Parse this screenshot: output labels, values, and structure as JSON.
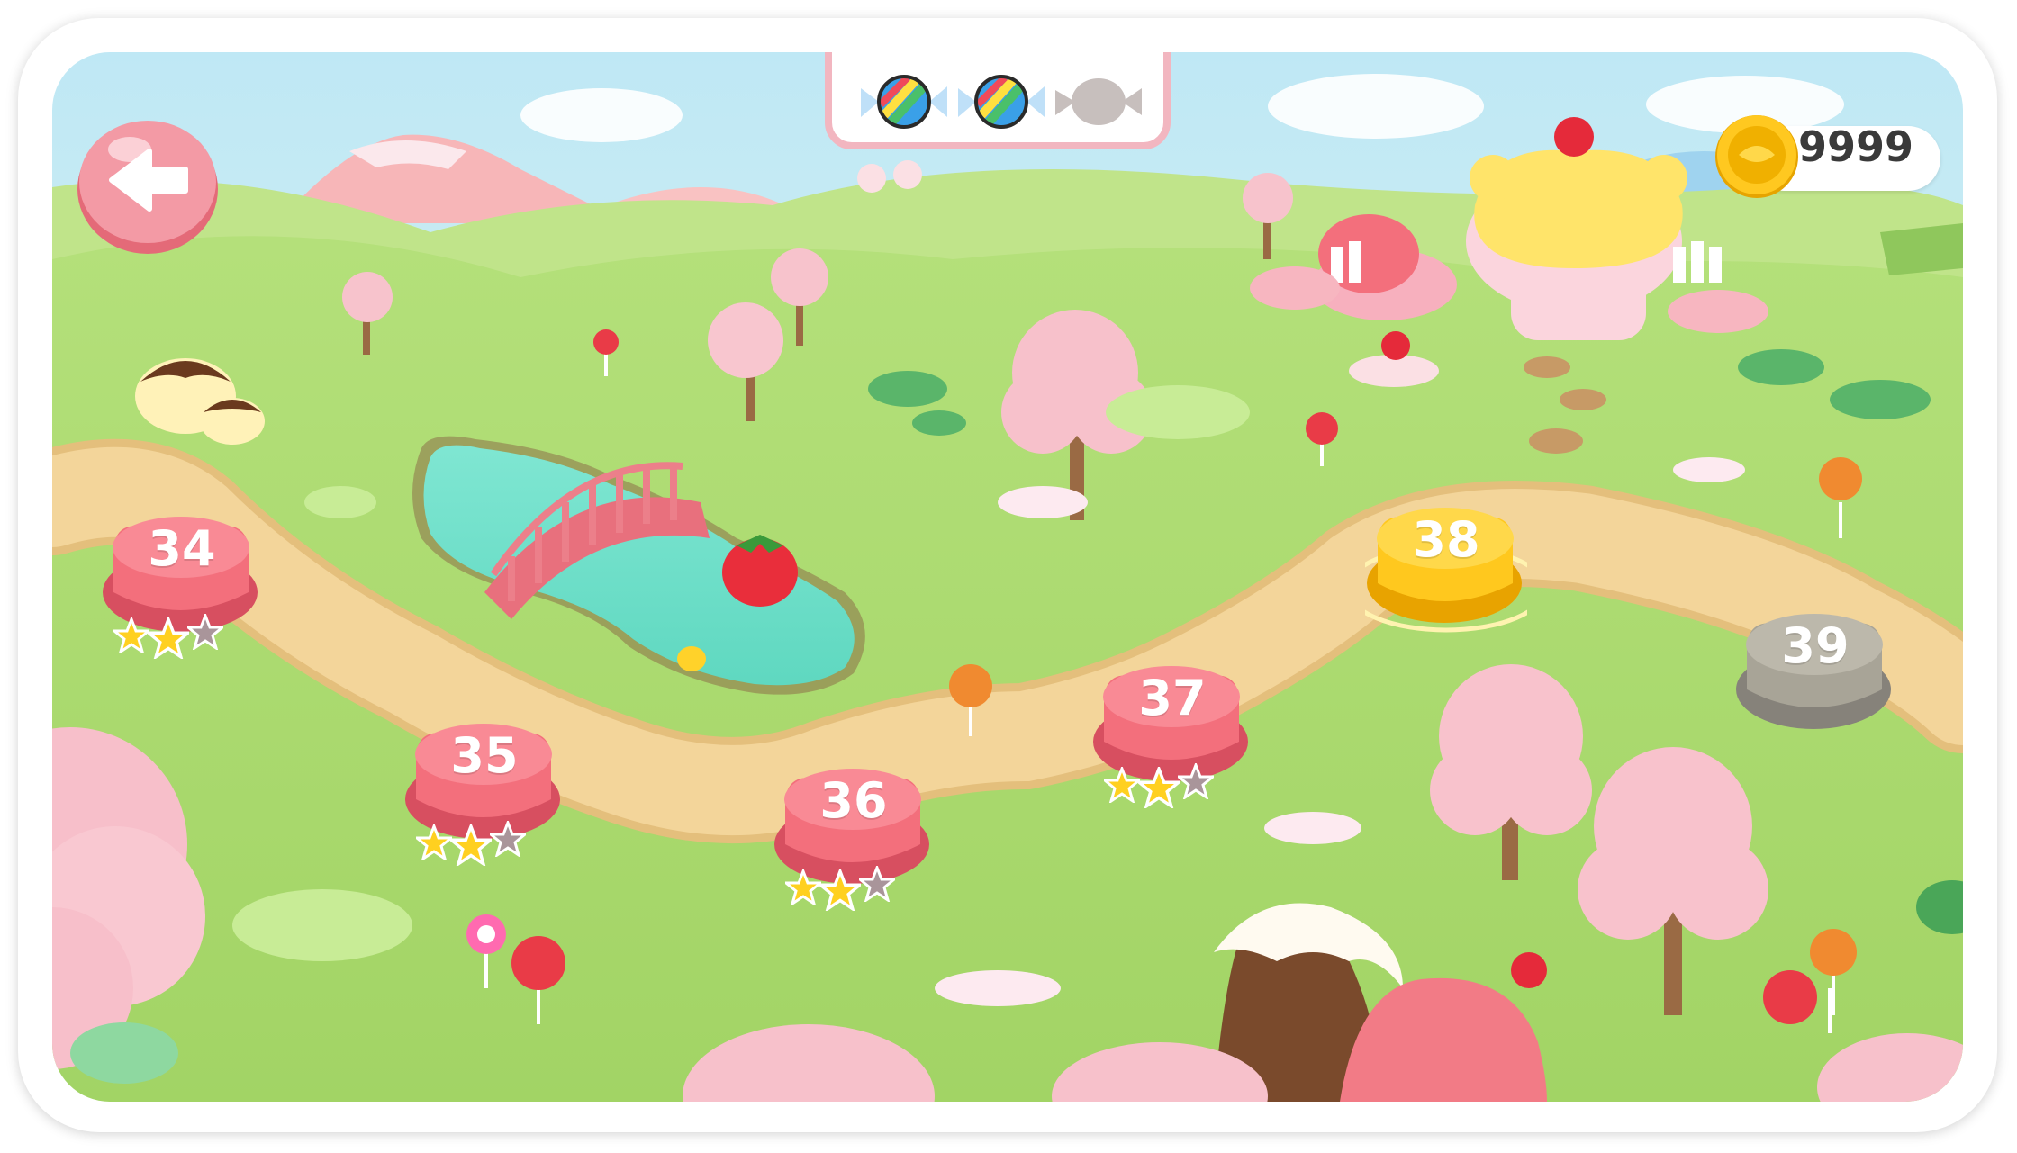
{
  "hud": {
    "back_icon": "arrow-left-icon",
    "candies": [
      {
        "name": "rainbow-candy-icon",
        "collected": true
      },
      {
        "name": "rainbow-candy-icon",
        "collected": true
      },
      {
        "name": "candy-silhouette-icon",
        "collected": false
      }
    ],
    "coin_icon": "gold-coin-icon",
    "coins": "9999"
  },
  "levels": [
    {
      "label": "34",
      "state": "completed",
      "stars": 2
    },
    {
      "label": "35",
      "state": "completed",
      "stars": 2
    },
    {
      "label": "36",
      "state": "completed",
      "stars": 2
    },
    {
      "label": "37",
      "state": "completed",
      "stars": 2
    },
    {
      "label": "38",
      "state": "current",
      "stars": 0
    },
    {
      "label": "39",
      "state": "locked",
      "stars": 0
    }
  ],
  "colors": {
    "grass": "#a9d86a",
    "path": "#f1d194",
    "level_completed": "#f36f7c",
    "level_current": "#ffc81e",
    "level_locked": "#a8a497",
    "star_earned": "#ffd020",
    "star_empty": "#a9959a"
  }
}
